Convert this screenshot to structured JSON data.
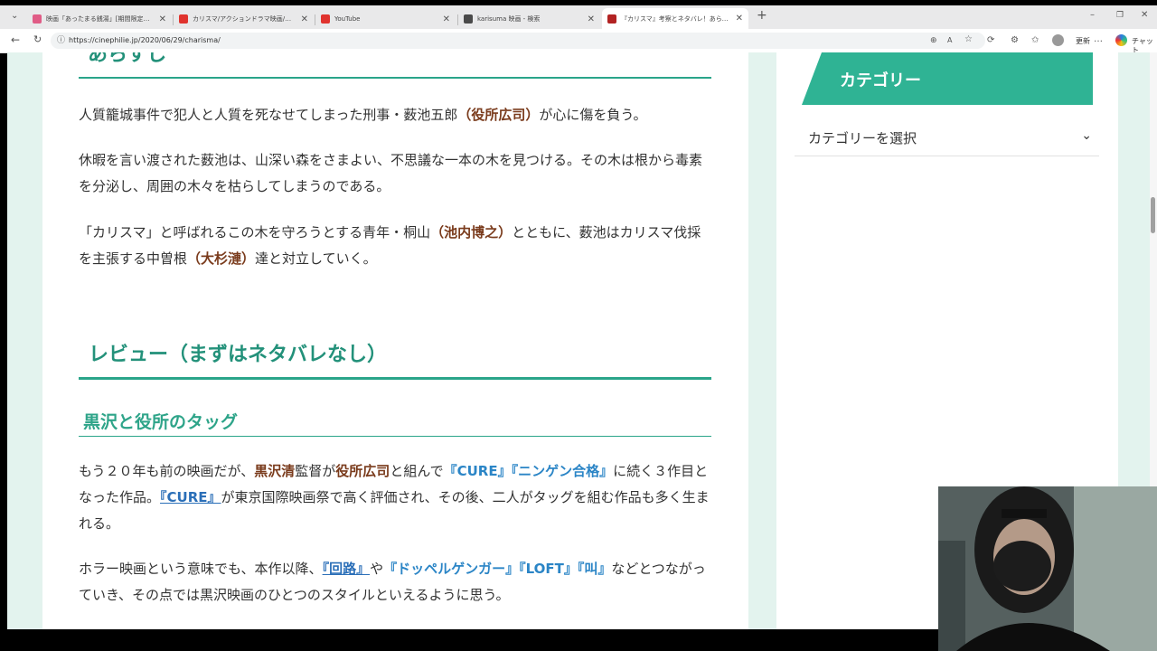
{
  "browser": {
    "tabs": [
      {
        "title": "映画「あったまる銭湯」[期間限定公開",
        "favicon_color": "#e05c86"
      },
      {
        "title": "カリスマ/アクションドラマ映画/映画評論",
        "favicon_color": "#e0332e"
      },
      {
        "title": "YouTube",
        "favicon_color": "#e0332e"
      },
      {
        "title": "karisuma 映画 - 検索",
        "favicon_color": "#4a4a4a"
      },
      {
        "title": "『カリスマ』考察とネタバレ！あらすじ・",
        "favicon_color": "#b22222"
      }
    ],
    "active_tab": 4,
    "url": "https://cinephilie.jp/2020/06/29/charisma/",
    "update_label": "更新",
    "more_label": "…",
    "chat_label": "チャット"
  },
  "article": {
    "section_title_partial": "あらすじ",
    "synopsis_1": [
      {
        "t": "人質籠城事件で犯人と人質を死なせてしまった刑事・薮池五郎",
        "s": ""
      },
      {
        "t": "（役所広司）",
        "s": "cast"
      },
      {
        "t": "が心に傷を負う。",
        "s": ""
      }
    ],
    "synopsis_2": [
      {
        "t": "休暇を言い渡された薮池は、山深い森をさまよい、不思議な一本の木を見つける。その木は根から毒素を分泌し、周囲の木々を枯らしてしまうのである。",
        "s": ""
      }
    ],
    "synopsis_3": [
      {
        "t": "「カリスマ」と呼ばれるこの木を守ろうとする青年・桐山",
        "s": ""
      },
      {
        "t": "（池内博之）",
        "s": "cast"
      },
      {
        "t": "とともに、薮池はカリスマ伐採を主張する中曽根",
        "s": ""
      },
      {
        "t": "（大杉漣）",
        "s": "cast"
      },
      {
        "t": "達と対立していく。",
        "s": ""
      }
    ],
    "review_heading": "レビュー（まずはネタバレなし）",
    "subheading": "黒沢と役所のタッグ",
    "review_1": [
      {
        "t": "もう２０年も前の映画だが、",
        "s": ""
      },
      {
        "t": "黒沢清",
        "s": "cast"
      },
      {
        "t": "監督が",
        "s": ""
      },
      {
        "t": "役所広司",
        "s": "cast"
      },
      {
        "t": "と組んで",
        "s": ""
      },
      {
        "t": "『CURE』『ニンゲン合格』",
        "s": "film"
      },
      {
        "t": "に続く３作目となった作品。",
        "s": ""
      },
      {
        "t": "『CURE』",
        "s": "filmu"
      },
      {
        "t": "が東京国際映画祭で高く評価され、その後、二人がタッグを組む作品も多く生まれる。",
        "s": ""
      }
    ],
    "review_2": [
      {
        "t": "ホラー映画という意味でも、本作以降、",
        "s": ""
      },
      {
        "t": "『回路』",
        "s": "filmu"
      },
      {
        "t": "や",
        "s": ""
      },
      {
        "t": "『ドッペルゲンガー』『LOFT』『叫』",
        "s": "film"
      },
      {
        "t": "などとつながっていき、その点では黒沢映画のひとつのスタイルといえるように思う。",
        "s": ""
      }
    ]
  },
  "sidebar": {
    "category_title": "カテゴリー",
    "category_select": "カテゴリーを選択"
  },
  "colors": {
    "accent": "#2aa58a",
    "heading": "#23917a",
    "cast": "#7a3b1c",
    "film": "#2b85c6",
    "page_bg": "#e3f3ee"
  }
}
